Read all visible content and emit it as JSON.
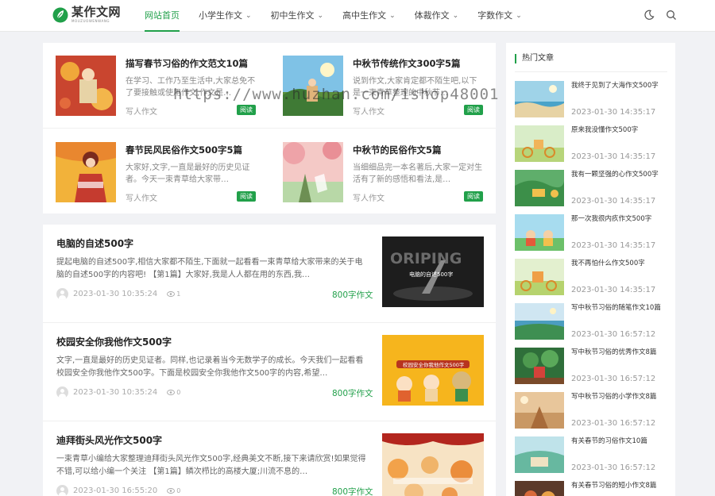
{
  "header": {
    "logo_title": "某作文网",
    "logo_sub": "MOUZUOWENWANG",
    "nav": [
      {
        "label": "网站首页",
        "active": true,
        "has_menu": false
      },
      {
        "label": "小学生作文",
        "active": false,
        "has_menu": true
      },
      {
        "label": "初中生作文",
        "active": false,
        "has_menu": true
      },
      {
        "label": "高中生作文",
        "active": false,
        "has_menu": true
      },
      {
        "label": "体裁作文",
        "active": false,
        "has_menu": true
      },
      {
        "label": "字数作文",
        "active": false,
        "has_menu": true
      }
    ],
    "icons": [
      "moon-icon",
      "search-icon"
    ],
    "accent": "#21a04a"
  },
  "featured": [
    {
      "title": "描写春节习俗的作文范文10篇",
      "desc": "在学习、工作乃至生活中,大家总免不了要接触或使用作文,作文是…",
      "category": "写人作文",
      "badge": "阅读"
    },
    {
      "title": "中秋节传统作文300字5篇",
      "desc": "说到作文,大家肯定都不陌生吧,以下是一束青草整理的中秋节…",
      "category": "写人作文",
      "badge": "阅读"
    },
    {
      "title": "春节民风民俗作文500字5篇",
      "desc": "大家好,文字,一直是最好的历史见证者。今天一束青草给大家带…",
      "category": "写人作文",
      "badge": "阅读"
    },
    {
      "title": "中秋节的民俗作文5篇",
      "desc": "当细细品完一本名著后,大家一定对生活有了新的感悟和看法,是…",
      "category": "写人作文",
      "badge": "阅读"
    }
  ],
  "articles": [
    {
      "title": "电脑的自述500字",
      "desc": "提起电脑的自述500字,相信大家都不陌生,下面就一起看看一束青草给大家带来的关于电脑的自述500字的内容吧! 【第1篇】大家好,我是人人都在用的东西,我…",
      "date": "2023-01-30 10:35:24",
      "views": "1",
      "category": "800字作文"
    },
    {
      "title": "校园安全你我他作文500字",
      "desc": "文字,一直是最好的历史见证者。同样,也记录着当今无数学子的成长。今天我们一起看看校园安全你我他作文500字。下面是校园安全你我他作文500字的内容,希望…",
      "date": "2023-01-30 10:35:24",
      "views": "0",
      "category": "800字作文"
    },
    {
      "title": "迪拜街头风光作文500字",
      "desc": "一束青草小编给大家整理迪拜街头风光作文500字,经典美文不断,接下来请欣赏!如果觉得不错,可以给小编一个关注 【第1篇】鳞次栉比的高楼大厦;川流不息的…",
      "date": "2023-01-30 16:55:20",
      "views": "0",
      "category": "800字作文"
    }
  ],
  "sidebar": {
    "heading": "热门文章",
    "items": [
      {
        "title": "我终于见到了大海作文500字",
        "date": "2023-01-30 14:35:17"
      },
      {
        "title": "原来我没懂作文500字",
        "date": "2023-01-30 14:35:17"
      },
      {
        "title": "我有一颗坚强的心作文500字",
        "date": "2023-01-30 14:35:17"
      },
      {
        "title": "那一次我很内疚作文500字",
        "date": "2023-01-30 14:35:17"
      },
      {
        "title": "我不再怕什么作文500字",
        "date": "2023-01-30 14:35:17"
      },
      {
        "title": "写中秋节习俗的随笔作文10篇",
        "date": "2023-01-30 16:57:12"
      },
      {
        "title": "写中秋节习俗的优秀作文8篇",
        "date": "2023-01-30 16:57:12"
      },
      {
        "title": "写中秋节习俗的小学作文8篇",
        "date": "2023-01-30 16:57:12"
      },
      {
        "title": "有关春节的习俗作文10篇",
        "date": "2023-01-30 16:57:12"
      },
      {
        "title": "有关春节习俗的短小作文8篇",
        "date": ""
      }
    ]
  },
  "watermark": "https://www.huzhan.com/ishop48001",
  "thumb_texts": {
    "article_1": "电脑的自述500字",
    "article_2": "校园安全你我他作文500字"
  }
}
